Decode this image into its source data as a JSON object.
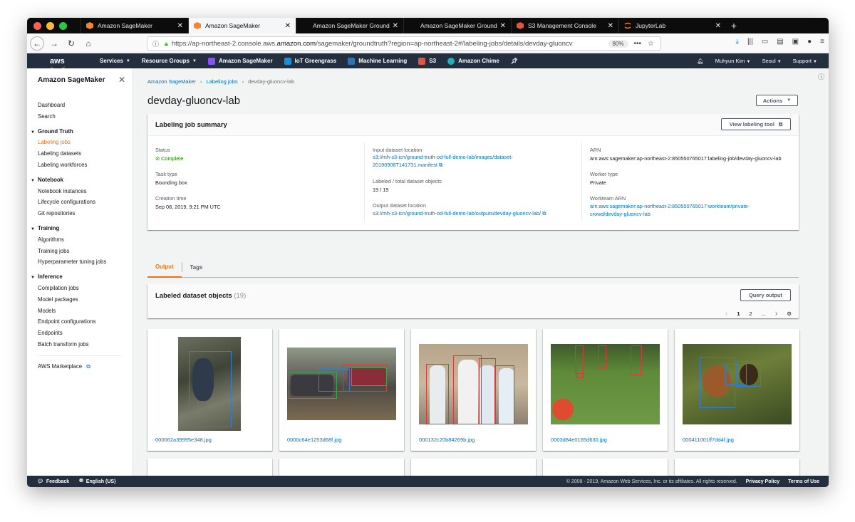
{
  "browser": {
    "tabs": [
      {
        "title": "Amazon SageMaker",
        "icon": "sagemaker-icon"
      },
      {
        "title": "Amazon SageMaker",
        "icon": "sagemaker-icon"
      },
      {
        "title": "Amazon SageMaker Ground Tru",
        "icon": "none"
      },
      {
        "title": "Amazon SageMaker Ground Tru",
        "icon": "none"
      },
      {
        "title": "S3 Management Console",
        "icon": "s3-icon"
      },
      {
        "title": "JupyterLab",
        "icon": "jupyter-icon"
      }
    ],
    "url_prefix": "https://ap-northeast-2.console.aws.",
    "url_domain": "amazon.com",
    "url_suffix": "/sagemaker/groundtruth?region=ap-northeast-2#/labeling-jobs/details/devday-gluoncv",
    "zoom": "80%"
  },
  "aws_header": {
    "logo": "aws",
    "services": "Services",
    "resource_groups": "Resource Groups",
    "shortcuts": [
      "Amazon SageMaker",
      "IoT Greengrass",
      "Machine Learning",
      "S3",
      "Amazon Chime"
    ],
    "user": "Muhyun Kim",
    "region": "Seoul",
    "support": "Support"
  },
  "sidenav": {
    "title": "Amazon SageMaker",
    "top_items": [
      "Dashboard",
      "Search"
    ],
    "sections": [
      {
        "title": "Ground Truth",
        "items": [
          "Labeling jobs",
          "Labeling datasets",
          "Labeling workforces"
        ]
      },
      {
        "title": "Notebook",
        "items": [
          "Notebook instances",
          "Lifecycle configurations",
          "Git repositories"
        ]
      },
      {
        "title": "Training",
        "items": [
          "Algorithms",
          "Training jobs",
          "Hyperparameter tuning jobs"
        ]
      },
      {
        "title": "Inference",
        "items": [
          "Compilation jobs",
          "Model packages",
          "Models",
          "Endpoint configurations",
          "Endpoints",
          "Batch transform jobs"
        ]
      }
    ],
    "active_item": "Labeling jobs",
    "marketplace": "AWS Marketplace"
  },
  "breadcrumb": {
    "root": "Amazon SageMaker",
    "parent": "Labeling jobs",
    "current": "devday-gluoncv-lab"
  },
  "page_title": "devday-gluoncv-lab",
  "actions_label": "Actions",
  "summary": {
    "title": "Labeling job summary",
    "view_tool_label": "View labeling tool",
    "status_label": "Status",
    "status_value": "Complete",
    "task_type_label": "Task type",
    "task_type_value": "Bounding box",
    "creation_time_label": "Creation time",
    "creation_time_value": "Sep 08, 2019, 9:21 PM UTC",
    "input_label": "Input dataset location",
    "input_value_1": "s3://mh-s3-icn/ground-truth-od-full-demo-lab/images/dataset-",
    "input_value_2": "20190908T141731.manifest",
    "labeled_label": "Labeled / total dataset objects",
    "labeled_value": "19 / 19",
    "output_label": "Output dataset location",
    "output_value": "s3://mh-s3-icn/ground-truth-od-full-demo-lab/outputs/devday-gluoncv-lab/",
    "arn_label": "ARN",
    "arn_value": "arn:aws:sagemaker:ap-northeast-2:850550765017:labeling-job/devday-gluoncv-lab",
    "worker_type_label": "Worker type",
    "worker_type_value": "Private",
    "workteam_label": "Workteam ARN",
    "workteam_value_1": "arn:aws:sagemaker:ap-northeast-2:850550765017:workteam/private-",
    "workteam_value_2": "crowd/devday-gluoncv-lab"
  },
  "tabs": [
    "Output",
    "Tags"
  ],
  "dataset_objects": {
    "title": "Labeled dataset objects",
    "count": "(19)",
    "query_label": "Query output",
    "pages": [
      "1",
      "2",
      "..."
    ],
    "files": [
      "000062a39995e348.jpg",
      "0000c64e1253d68f.jpg",
      "000132c20b84269b.jpg",
      "0003d84e0165d630.jpg",
      "000411001ff7dd4f.jpg"
    ]
  },
  "footer": {
    "feedback": "Feedback",
    "language": "English (US)",
    "copyright": "© 2008 - 2019, Amazon Web Services, Inc. or its affiliates. All rights reserved.",
    "privacy": "Privacy Policy",
    "terms": "Terms of Use"
  },
  "colors": {
    "accent": "#ec7211",
    "link": "#0073bb",
    "success": "#1d8102",
    "aws_nav": "#232f3e"
  }
}
